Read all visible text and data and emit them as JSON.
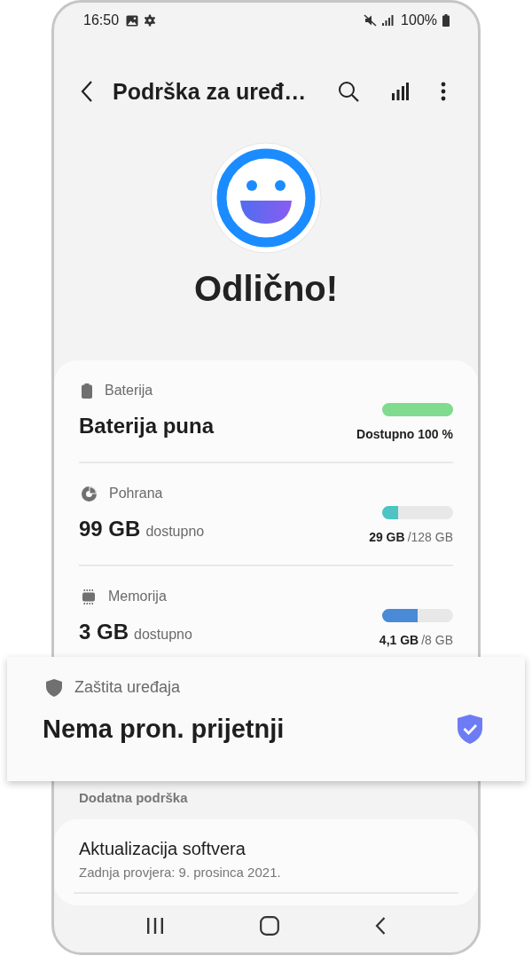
{
  "status_bar": {
    "time": "16:50",
    "battery": "100%"
  },
  "app_bar": {
    "title": "Podrška za uređ…"
  },
  "status": {
    "headline": "Odlično!"
  },
  "items": [
    {
      "kind": "battery",
      "label": "Baterija",
      "value": "Baterija puna",
      "level": 1,
      "color": "#7fdb8e",
      "reading_strong": "Dostupno 100 %"
    },
    {
      "kind": "storage",
      "label": "Pohrana",
      "value": "99 GB",
      "unit": "dostupno",
      "level": 0.23,
      "color": "#4ec3c4",
      "reading_strong": "29 GB",
      "reading_rest": "/128 GB"
    },
    {
      "kind": "memory",
      "label": "Memorija",
      "value": "3 GB",
      "unit": "dostupno",
      "level": 0.5,
      "color": "#4a8ad6",
      "reading_strong": "4,1 GB",
      "reading_rest": "/8 GB"
    }
  ],
  "protection": {
    "label": "Zaštita uređaja",
    "value": "Nema pron. prijetnji"
  },
  "section": {
    "title": "Dodatna podrška",
    "items": [
      {
        "title": "Aktualizacija softvera",
        "subtitle": "Zadnja provjera: 9. prosinca 2021."
      }
    ]
  }
}
